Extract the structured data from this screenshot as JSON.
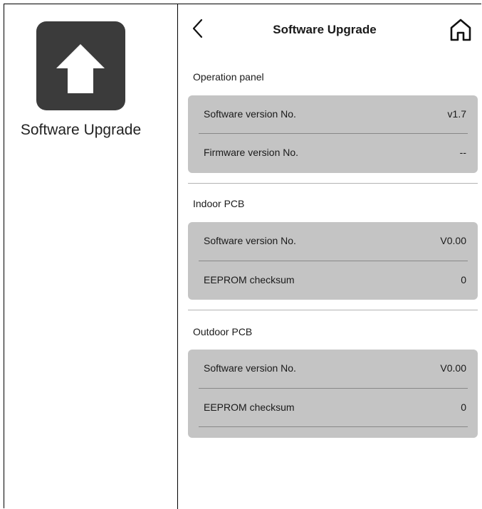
{
  "sidebar": {
    "app_label": "Software Upgrade",
    "app_icon": "upload-arrow-icon",
    "tile_color": "#3b3b3b"
  },
  "header": {
    "title": "Software Upgrade",
    "back_icon": "chevron-left-icon",
    "home_icon": "home-icon"
  },
  "sections": [
    {
      "title": "Operation panel",
      "rows": [
        {
          "label": "Software version No.",
          "value": "v1.7"
        },
        {
          "label": "Firmware version No.",
          "value": "--"
        }
      ]
    },
    {
      "title": "Indoor PCB",
      "rows": [
        {
          "label": "Software version No.",
          "value": "V0.00"
        },
        {
          "label": "EEPROM checksum",
          "value": "0"
        }
      ]
    },
    {
      "title": "Outdoor PCB",
      "rows": [
        {
          "label": "Software version No.",
          "value": "V0.00"
        },
        {
          "label": "EEPROM checksum",
          "value": "0"
        }
      ]
    }
  ],
  "colors": {
    "card_bg": "#c4c4c4",
    "text": "#1a1a1a"
  }
}
